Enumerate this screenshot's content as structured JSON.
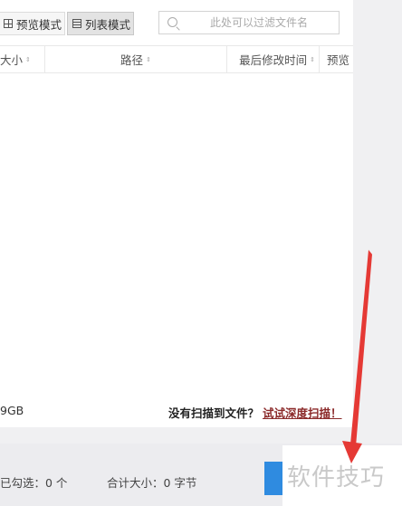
{
  "toolbar": {
    "preview_mode_label": "预览模式",
    "list_mode_label": "列表模式",
    "search_placeholder": "此处可以过滤文件名"
  },
  "table": {
    "columns": [
      "大小",
      "路径",
      "最后修改时间",
      "预览"
    ]
  },
  "status": {
    "total_size_text": "9GB",
    "no_files_text": "没有扫描到文件？",
    "deep_scan_link": "试试深度扫描！"
  },
  "footer": {
    "checked_text": "已勾选：0 个",
    "total_size_text": "合计大小：0 字节"
  },
  "watermark": "软件技巧",
  "colors": {
    "accent": "#2f8be0",
    "deep_scan_link": "#8b2a2a",
    "annotation_arrow": "#e53935"
  }
}
